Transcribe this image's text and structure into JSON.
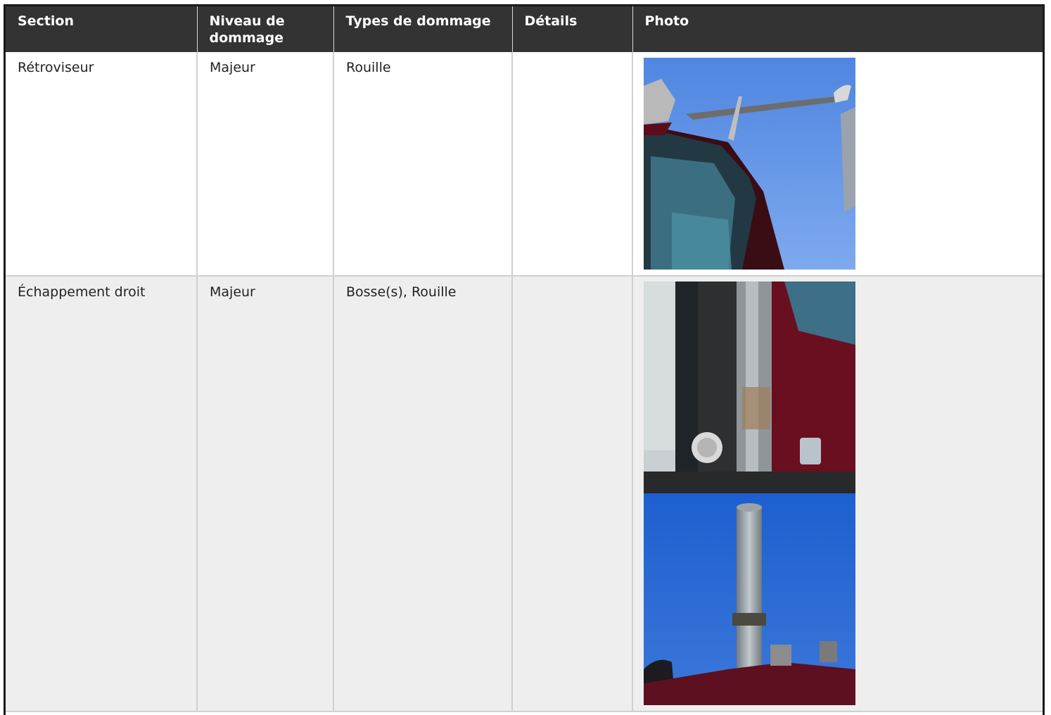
{
  "table": {
    "headers": [
      "Section",
      "Niveau de dommage",
      "Types de dommage",
      "Détails",
      "Photo"
    ],
    "rows": [
      {
        "section": "Rétroviseur",
        "level": "Majeur",
        "types": "Rouille",
        "details": "",
        "photos": [
          "mirror-photo"
        ]
      },
      {
        "section": "Échappement droit",
        "level": "Majeur",
        "types": "Bosse(s), Rouille",
        "details": "",
        "photos": [
          "exhaust-photo-1",
          "exhaust-photo-2"
        ]
      }
    ]
  },
  "colors": {
    "header_bg": "#333333",
    "row_alt_bg": "#eeeeee",
    "border": "#d0d0d0"
  }
}
